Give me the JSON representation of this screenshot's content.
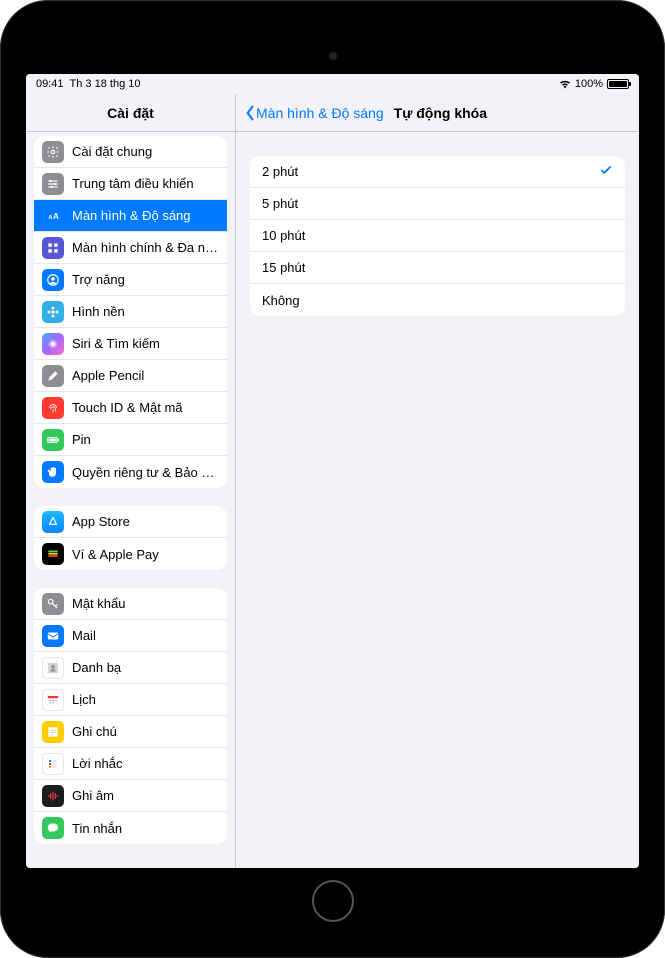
{
  "status": {
    "time": "09:41",
    "date": "Th 3 18 thg 10",
    "battery_text": "100%"
  },
  "sidebar": {
    "title": "Cài đặt",
    "groups": [
      {
        "rows": [
          {
            "id": "general",
            "label": "Cài đặt chung",
            "icon": "gear",
            "bg": "bg-gray"
          },
          {
            "id": "control",
            "label": "Trung tâm điều khiển",
            "icon": "sliders",
            "bg": "bg-gray"
          },
          {
            "id": "display",
            "label": "Màn hình & Độ sáng",
            "icon": "text-size",
            "bg": "bg-blue",
            "selected": true
          },
          {
            "id": "home",
            "label": "Màn hình chính & Đa nhiệm",
            "icon": "grid",
            "bg": "bg-indigo"
          },
          {
            "id": "accessibility",
            "label": "Trợ năng",
            "icon": "person",
            "bg": "bg-blue"
          },
          {
            "id": "wallpaper",
            "label": "Hình nền",
            "icon": "flower",
            "bg": "bg-cyan"
          },
          {
            "id": "siri",
            "label": "Siri & Tìm kiếm",
            "icon": "siri",
            "bg": "bg-siri"
          },
          {
            "id": "pencil",
            "label": "Apple Pencil",
            "icon": "pencil",
            "bg": "bg-gray"
          },
          {
            "id": "touchid",
            "label": "Touch ID & Mật mã",
            "icon": "fingerprint",
            "bg": "bg-red"
          },
          {
            "id": "battery",
            "label": "Pin",
            "icon": "battery",
            "bg": "bg-green"
          },
          {
            "id": "privacy",
            "label": "Quyền riêng tư & Bảo mật",
            "icon": "hand",
            "bg": "bg-blue"
          }
        ]
      },
      {
        "rows": [
          {
            "id": "appstore",
            "label": "App Store",
            "icon": "appstore",
            "bg": "bg-appstore"
          },
          {
            "id": "wallet",
            "label": "Ví & Apple Pay",
            "icon": "wallet",
            "bg": "bg-wallet"
          }
        ]
      },
      {
        "rows": [
          {
            "id": "passwords",
            "label": "Mật khẩu",
            "icon": "key",
            "bg": "bg-gray"
          },
          {
            "id": "mail",
            "label": "Mail",
            "icon": "mail",
            "bg": "bg-blue"
          },
          {
            "id": "contacts",
            "label": "Danh bạ",
            "icon": "contacts",
            "bg": "bg-white"
          },
          {
            "id": "calendar",
            "label": "Lịch",
            "icon": "calendar",
            "bg": "bg-white"
          },
          {
            "id": "notes",
            "label": "Ghi chú",
            "icon": "notes",
            "bg": "bg-yellow"
          },
          {
            "id": "reminders",
            "label": "Lời nhắc",
            "icon": "reminders",
            "bg": "bg-white"
          },
          {
            "id": "voicememos",
            "label": "Ghi âm",
            "icon": "waveform",
            "bg": "bg-black"
          },
          {
            "id": "messages",
            "label": "Tin nhắn",
            "icon": "message",
            "bg": "bg-green"
          }
        ]
      }
    ]
  },
  "detail": {
    "back_label": "Màn hình & Độ sáng",
    "title": "Tự động khóa",
    "options": [
      {
        "label": "2 phút",
        "selected": true
      },
      {
        "label": "5 phút",
        "selected": false
      },
      {
        "label": "10 phút",
        "selected": false
      },
      {
        "label": "15 phút",
        "selected": false
      },
      {
        "label": "Không",
        "selected": false
      }
    ]
  }
}
